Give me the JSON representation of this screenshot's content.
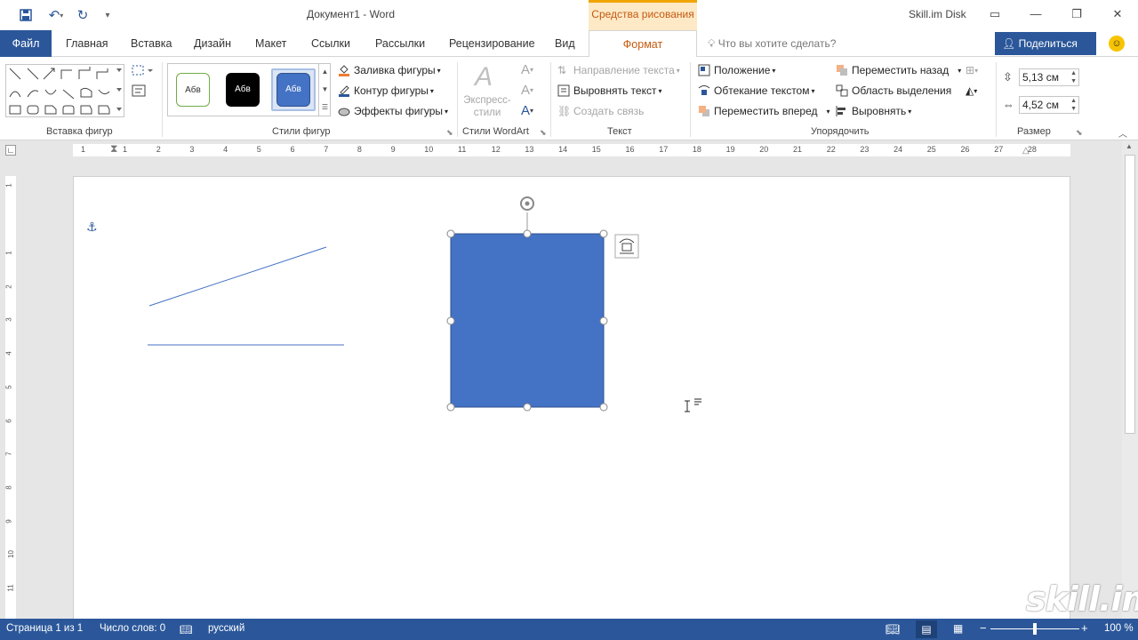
{
  "window": {
    "title": "Документ1  -  Word",
    "context_tab_title": "Средства рисования",
    "account": "Skill.im Disk"
  },
  "tabs": [
    {
      "label": "Файл"
    },
    {
      "label": "Главная"
    },
    {
      "label": "Вставка"
    },
    {
      "label": "Дизайн"
    },
    {
      "label": "Макет"
    },
    {
      "label": "Ссылки"
    },
    {
      "label": "Рассылки"
    },
    {
      "label": "Рецензирование"
    },
    {
      "label": "Вид"
    },
    {
      "label": "Формат"
    }
  ],
  "tell_me": "Что вы хотите сделать?",
  "share_label": "Поделиться",
  "ribbon": {
    "groups": {
      "insert_shapes": "Вставка фигур",
      "shape_styles": "Стили фигур",
      "wordart_styles": "Стили WordArt",
      "text": "Текст",
      "arrange": "Упорядочить",
      "size": "Размер"
    },
    "style_samples": [
      "Абв",
      "Абв",
      "Абв"
    ],
    "shape_fill": "Заливка фигуры",
    "shape_outline": "Контур фигуры",
    "shape_effects": "Эффекты фигуры",
    "quick_styles": "Экспресс-\nстили",
    "text_direction": "Направление текста",
    "align_text": "Выровнять текст",
    "create_link": "Создать связь",
    "position": "Положение",
    "wrap_text": "Обтекание текстом",
    "bring_forward": "Переместить вперед",
    "send_backward": "Переместить назад",
    "selection_pane": "Область выделения",
    "align": "Выровнять",
    "height_value": "5,13 см",
    "width_value": "4,52 см"
  },
  "ruler_numbers": [
    "1",
    "1",
    "2",
    "3",
    "4",
    "5",
    "6",
    "7",
    "8",
    "9",
    "10",
    "11",
    "12",
    "13",
    "14",
    "15",
    "16",
    "17",
    "18",
    "19",
    "20",
    "21",
    "22",
    "23",
    "24",
    "25",
    "26",
    "27",
    "28"
  ],
  "vruler_numbers": [
    "1",
    "1",
    "2",
    "3",
    "4",
    "5",
    "6",
    "7",
    "8",
    "9",
    "10",
    "11"
  ],
  "status": {
    "page": "Страница 1 из 1",
    "words": "Число слов: 0",
    "language": "русский",
    "zoom": "100 %"
  },
  "watermark": "skill.im",
  "colors": {
    "brand": "#2b579a",
    "context": "#c55a11",
    "shape_fill": "#4472c4",
    "shape_outline": "#2f528f"
  }
}
